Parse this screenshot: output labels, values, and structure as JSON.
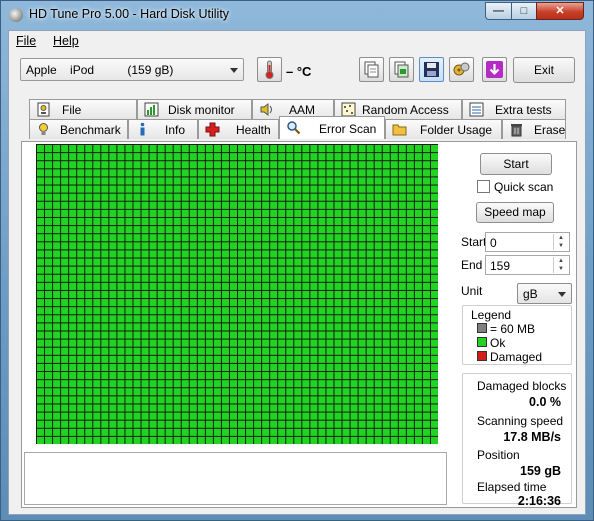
{
  "window": {
    "title": "HD Tune Pro 5.00 - Hard Disk Utility"
  },
  "menu": {
    "file": "File",
    "help": "Help"
  },
  "toolbar": {
    "drive": "Apple    iPod          (159 gB)",
    "temperature": "– °C",
    "exit_label": "Exit"
  },
  "tabs_top": [
    {
      "label": "File Benchmark",
      "icon": "file-benchmark-icon"
    },
    {
      "label": "Disk monitor",
      "icon": "disk-monitor-icon"
    },
    {
      "label": "AAM",
      "icon": "speaker-icon"
    },
    {
      "label": "Random Access",
      "icon": "random-access-icon"
    },
    {
      "label": "Extra tests",
      "icon": "extra-tests-icon"
    }
  ],
  "tabs_bottom": [
    {
      "label": "Benchmark",
      "icon": "lightbulb-icon"
    },
    {
      "label": "Info",
      "icon": "info-icon"
    },
    {
      "label": "Health",
      "icon": "health-cross-icon"
    },
    {
      "label": "Error Scan",
      "icon": "magnifier-icon",
      "active": true
    },
    {
      "label": "Folder Usage",
      "icon": "folder-icon"
    },
    {
      "label": "Erase",
      "icon": "trash-icon"
    }
  ],
  "scan": {
    "start_label": "Start",
    "quick_scan_label": "Quick scan",
    "quick_scan_checked": false,
    "speed_map_label": "Speed map",
    "start_field_label": "Start",
    "start_value": "0",
    "end_field_label": "End",
    "end_value": "159",
    "unit_label": "Unit",
    "unit_value": "gB",
    "grid_block_color": "#22d422",
    "grid_line_color": "#1a1a1a",
    "blocks_scanned_fraction": 1.0
  },
  "legend": {
    "title": "Legend",
    "items": [
      {
        "label": "= 60 MB",
        "color": "#808080"
      },
      {
        "label": "Ok",
        "color": "#22d422"
      },
      {
        "label": "Damaged",
        "color": "#d41c1c"
      }
    ]
  },
  "stats": {
    "damaged_label": "Damaged blocks",
    "damaged_value": "0.0 %",
    "speed_label": "Scanning speed",
    "speed_value": "17.8 MB/s",
    "position_label": "Position",
    "position_value": "159 gB",
    "elapsed_label": "Elapsed time",
    "elapsed_value": "2:16:36"
  }
}
